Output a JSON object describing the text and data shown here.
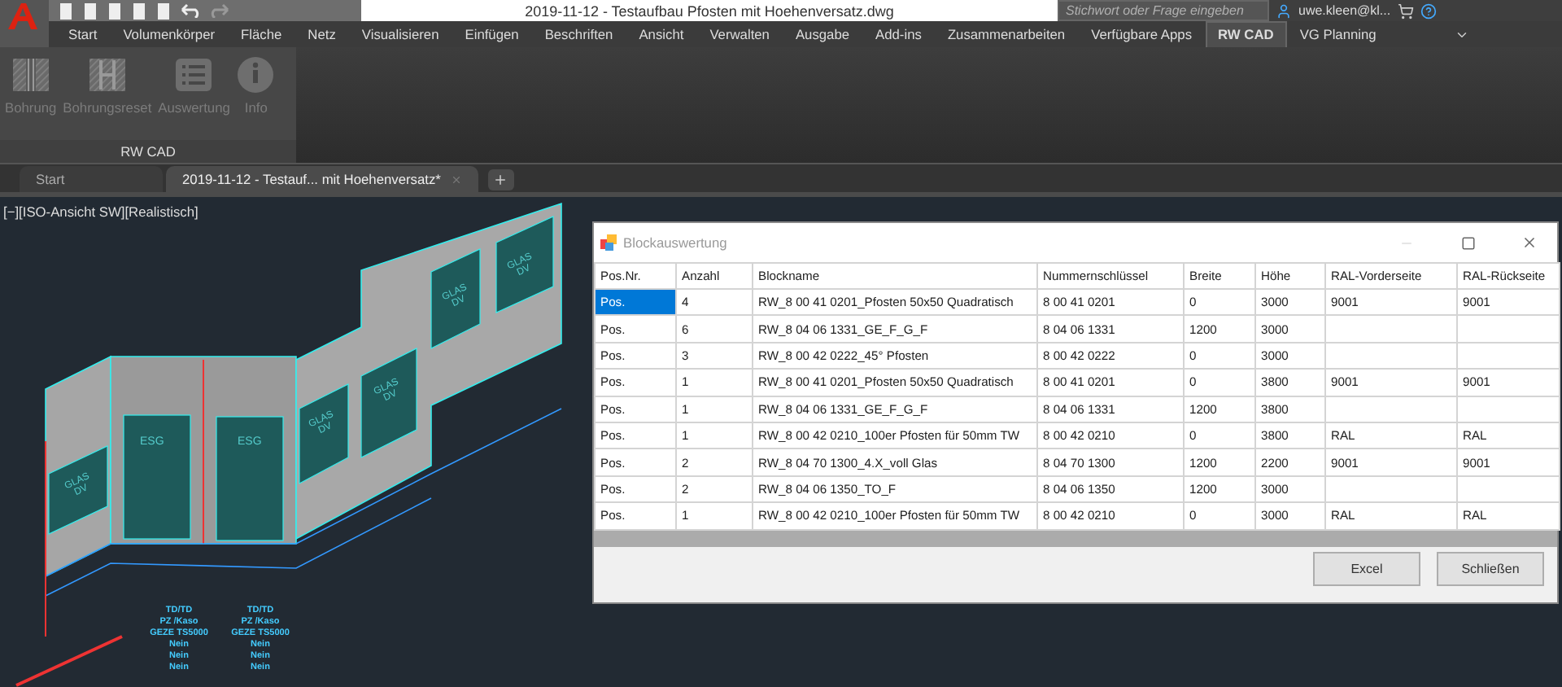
{
  "window": {
    "title": "2019-11-12 - Testaufbau Pfosten mit Hoehenversatz.dwg",
    "search": {
      "placeholder": "Stichwort oder Frage eingeben"
    },
    "user": "uwe.kleen@kl..."
  },
  "menu_tabs": [
    {
      "label": "Start",
      "selected": false
    },
    {
      "label": "Volumenkörper",
      "selected": false
    },
    {
      "label": "Fläche",
      "selected": false
    },
    {
      "label": "Netz",
      "selected": false
    },
    {
      "label": "Visualisieren",
      "selected": false
    },
    {
      "label": "Einfügen",
      "selected": false
    },
    {
      "label": "Beschriften",
      "selected": false
    },
    {
      "label": "Ansicht",
      "selected": false
    },
    {
      "label": "Verwalten",
      "selected": false
    },
    {
      "label": "Ausgabe",
      "selected": false
    },
    {
      "label": "Add-ins",
      "selected": false
    },
    {
      "label": "Zusammenarbeiten",
      "selected": false
    },
    {
      "label": "Verfügbare Apps",
      "selected": false
    },
    {
      "label": "RW CAD",
      "selected": true
    },
    {
      "label": "VG Planning",
      "selected": false
    }
  ],
  "ribbon": {
    "panel": "RW CAD",
    "buttons": [
      {
        "label": "Bohrung",
        "kind": "drill",
        "disabled": true
      },
      {
        "label": "Bohrungsreset",
        "kind": "reset",
        "disabled": true
      },
      {
        "label": "Auswertung",
        "kind": "list",
        "disabled": true
      },
      {
        "label": "Info",
        "kind": "info",
        "disabled": true
      }
    ]
  },
  "doc_tabs": [
    {
      "label": "Start",
      "selected": false
    },
    {
      "label": "2019-11-12 - Testauf... mit Hoehenversatz*",
      "selected": true
    }
  ],
  "viewport": {
    "label": "[−][ISO-Ansicht SW][Realistisch]",
    "glass_labels": [
      [
        "GLAS",
        "DV"
      ],
      [
        "GLAS",
        "DV"
      ],
      [
        "GLAS",
        "DV"
      ],
      [
        "GLAS",
        "DV"
      ],
      [
        "GLAS",
        "DV"
      ]
    ],
    "door_labels": [
      "ESG",
      "ESG"
    ],
    "notes": [
      [
        "TD/TD",
        "PZ /Kaso",
        "GEZE TS5000",
        "Nein",
        "Nein",
        "Nein"
      ],
      [
        "TD/TD",
        "PZ /Kaso",
        "GEZE TS5000",
        "Nein",
        "Nein",
        "Nein"
      ]
    ]
  },
  "dialog": {
    "title": "Blockauswertung",
    "columns": [
      "Pos.Nr.",
      "Anzahl",
      "Blockname",
      "Nummernschlüssel",
      "Breite",
      "Höhe",
      "RAL-Vorderseite",
      "RAL-Rückseite"
    ],
    "rows": [
      {
        "selected": true,
        "cells": [
          "Pos.",
          "4",
          "RW_8 00 41 0201_Pfosten 50x50 Quadratisch",
          "8 00 41 0201",
          "0",
          "3000",
          "9001",
          "9001"
        ]
      },
      {
        "selected": false,
        "cells": [
          "Pos.",
          "6",
          "RW_8 04 06 1331_GE_F_G_F",
          "8 04 06 1331",
          "1200",
          "3000",
          "",
          ""
        ]
      },
      {
        "selected": false,
        "cells": [
          "Pos.",
          "3",
          "RW_8 00 42 0222_45° Pfosten",
          "8 00 42 0222",
          "0",
          "3000",
          "",
          ""
        ]
      },
      {
        "selected": false,
        "cells": [
          "Pos.",
          "1",
          "RW_8 00 41 0201_Pfosten 50x50 Quadratisch",
          "8 00 41 0201",
          "0",
          "3800",
          "9001",
          "9001"
        ]
      },
      {
        "selected": false,
        "cells": [
          "Pos.",
          "1",
          "RW_8 04 06 1331_GE_F_G_F",
          "8 04 06 1331",
          "1200",
          "3800",
          "",
          ""
        ]
      },
      {
        "selected": false,
        "cells": [
          "Pos.",
          "1",
          "RW_8 00 42 0210_100er Pfosten für 50mm TW",
          "8 00 42 0210",
          "0",
          "3800",
          "RAL",
          "RAL"
        ]
      },
      {
        "selected": false,
        "cells": [
          "Pos.",
          "2",
          "RW_8 04 70 1300_4.X_voll Glas",
          "8 04 70 1300",
          "1200",
          "2200",
          "9001",
          "9001"
        ]
      },
      {
        "selected": false,
        "cells": [
          "Pos.",
          "2",
          "RW_8 04 06 1350_TO_F",
          "8 04 06 1350",
          "1200",
          "3000",
          "",
          ""
        ]
      },
      {
        "selected": false,
        "cells": [
          "Pos.",
          "1",
          "RW_8 00 42 0210_100er Pfosten für 50mm TW",
          "8 00 42 0210",
          "0",
          "3000",
          "RAL",
          "RAL"
        ]
      }
    ],
    "buttons": [
      "Excel",
      "Schließen"
    ]
  }
}
